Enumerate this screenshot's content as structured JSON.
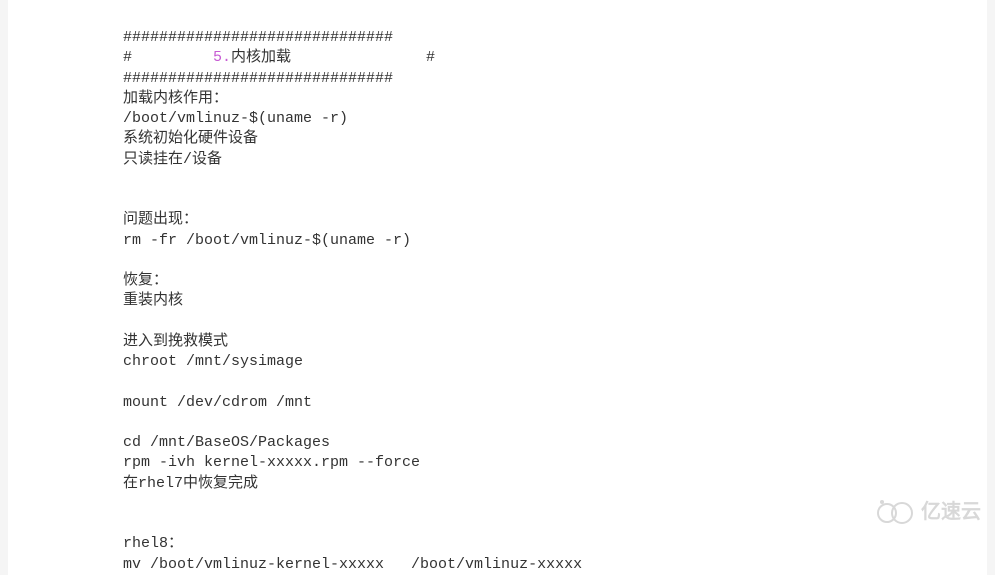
{
  "doc": {
    "lines": [
      {
        "text": "##############################"
      },
      {
        "text": "#         ",
        "highlight": "5.",
        "rest": "内核加载               #"
      },
      {
        "text": "##############################"
      },
      {
        "text": "加载内核作用："
      },
      {
        "text": "/boot/vmlinuz-$(uname -r)"
      },
      {
        "text": "系统初始化硬件设备"
      },
      {
        "text": "只读挂在/设备"
      },
      {
        "text": ""
      },
      {
        "text": ""
      },
      {
        "text": "问题出现："
      },
      {
        "text": "rm -fr /boot/vmlinuz-$(uname -r)"
      },
      {
        "text": ""
      },
      {
        "text": "恢复："
      },
      {
        "text": "重装内核"
      },
      {
        "text": ""
      },
      {
        "text": "进入到挽救模式"
      },
      {
        "text": "chroot /mnt/sysimage"
      },
      {
        "text": ""
      },
      {
        "text": "mount /dev/cdrom /mnt"
      },
      {
        "text": ""
      },
      {
        "text": "cd /mnt/BaseOS/Packages"
      },
      {
        "text": "rpm -ivh kernel-xxxxx.rpm --force"
      },
      {
        "text": "在rhel7中恢复完成"
      },
      {
        "text": ""
      },
      {
        "text": ""
      },
      {
        "text": "rhel8："
      },
      {
        "text": "mv /boot/vmlinuz-kernel-xxxxx   /boot/vmlinuz-xxxxx"
      }
    ]
  },
  "watermark": {
    "text": "亿速云"
  }
}
